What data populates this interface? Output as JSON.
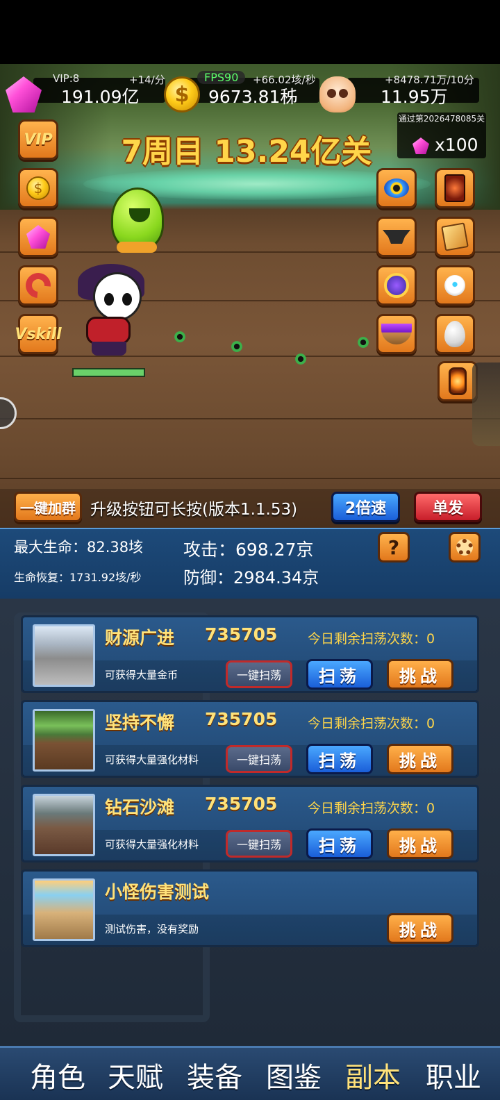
{
  "resources": {
    "gem": {
      "label": "VIP:8",
      "rate": "+14/分",
      "value": "191.09亿"
    },
    "coin": {
      "fps": "FPS90",
      "rate": "+66.02垓/秒",
      "value": "9673.81秭"
    },
    "skull": {
      "rate": "+8478.71万/10分",
      "value": "11.95万"
    }
  },
  "stage": {
    "title": "7周目 13.24亿关"
  },
  "pass_reward": {
    "text": "通过第2026478085关",
    "amount": "x100"
  },
  "side_left": [
    {
      "icon": "vip-icon",
      "text": "VIP"
    },
    {
      "icon": "coin-icon"
    },
    {
      "icon": "gem-icon"
    },
    {
      "icon": "magnet-icon"
    },
    {
      "icon": "vskill-icon",
      "text": "Vskill"
    }
  ],
  "controls": {
    "join_label": "一键加群",
    "tip": "升级按钮可长按(版本1.1.53)",
    "speed_label": "2倍速",
    "single_label": "单发"
  },
  "stats": {
    "max_hp": "最大生命：82.38垓",
    "regen": "生命恢复：1731.92垓/秒",
    "attack": "攻击：698.27京",
    "defense": "防御：2984.34京",
    "help_label": "?"
  },
  "dungeons": [
    {
      "name": "财源广进",
      "level": "735705",
      "remain": "今日剩余扫荡次数：0",
      "desc": "可获得大量金币",
      "sweep_all": "一键扫荡",
      "sweep": "扫荡",
      "challenge": "挑战"
    },
    {
      "name": "坚持不懈",
      "level": "735705",
      "remain": "今日剩余扫荡次数：0",
      "desc": "可获得大量强化材料",
      "sweep_all": "一键扫荡",
      "sweep": "扫荡",
      "challenge": "挑战"
    },
    {
      "name": "钻石沙滩",
      "level": "735705",
      "remain": "今日剩余扫荡次数：0",
      "desc": "可获得大量强化材料",
      "sweep_all": "一键扫荡",
      "sweep": "扫荡",
      "challenge": "挑战"
    },
    {
      "name": "小怪伤害测试",
      "desc": "测试伤害，没有奖励",
      "challenge": "挑战"
    }
  ],
  "tabs": [
    "角色",
    "天赋",
    "装备",
    "图鉴",
    "副本",
    "职业"
  ],
  "active_tab": "副本"
}
